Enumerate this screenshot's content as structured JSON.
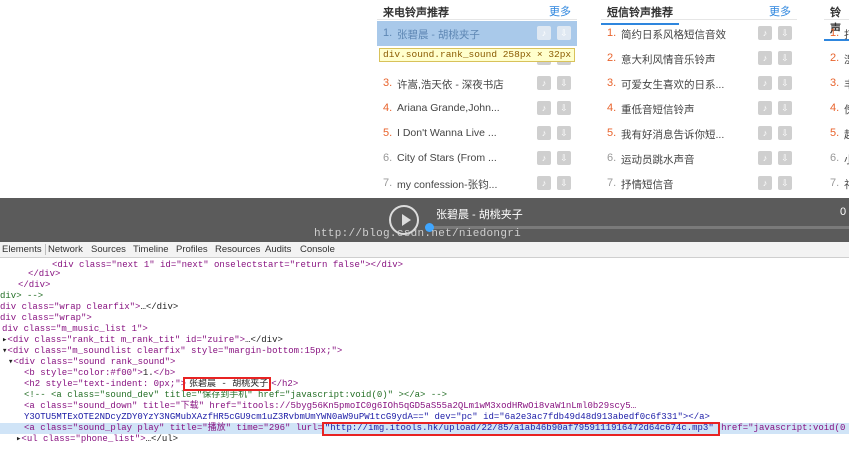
{
  "ringtone_panel": {
    "title": "来电铃声推荐",
    "more": "更多",
    "items": [
      {
        "num": "1.",
        "name": "张碧晨 - 胡桃夹子"
      },
      {
        "num": "2.",
        "name": ""
      },
      {
        "num": "3.",
        "name": "许嵩,浩天依 - 深夜书店"
      },
      {
        "num": "4.",
        "name": "Ariana Grande,John..."
      },
      {
        "num": "5.",
        "name": "I Don't Wanna Live ..."
      },
      {
        "num": "6.",
        "name": "City of Stars (From ..."
      },
      {
        "num": "7.",
        "name": "my confession-张钧..."
      }
    ]
  },
  "sms_panel": {
    "title": "短信铃声推荐",
    "more": "更多",
    "items": [
      {
        "num": "1.",
        "name": "简约日系风格短信音效"
      },
      {
        "num": "2.",
        "name": "意大利风情音乐铃声"
      },
      {
        "num": "3.",
        "name": "可爱女生喜欢的日系..."
      },
      {
        "num": "4.",
        "name": "重低音短信铃声"
      },
      {
        "num": "5.",
        "name": "我有好消息告诉你短..."
      },
      {
        "num": "6.",
        "name": "运动员跳水声音"
      },
      {
        "num": "7.",
        "name": "抒情短信音"
      }
    ]
  },
  "third_panel": {
    "title": "铃声",
    "items": [
      {
        "num": "1.",
        "name": "打"
      },
      {
        "num": "2.",
        "name": "湿"
      },
      {
        "num": "3.",
        "name": "丰"
      },
      {
        "num": "4.",
        "name": "傀"
      },
      {
        "num": "5.",
        "name": "起"
      },
      {
        "num": "6.",
        "name": "小"
      },
      {
        "num": "7.",
        "name": "礼"
      }
    ]
  },
  "tooltip": "div.sound.rank_sound 258px × 32px",
  "player": {
    "song": "张碧晨 - 胡桃夹子",
    "time": "0",
    "progress": 0
  },
  "watermark": "http://blog.csdn.net/niedongri",
  "devtools": {
    "tabs": [
      "Elements",
      "Network",
      "Sources",
      "Timeline",
      "Profiles",
      "Resources",
      "Audits",
      "Console"
    ]
  },
  "icons": {
    "ring_icon": "headphone-icon",
    "download_icon": "download-icon",
    "play_icon": "play-icon"
  },
  "colors": {
    "accent": "#2e86de",
    "hot_number": "#e8632c",
    "highlight_row": "#a9c9ea",
    "player_bg": "#5b5b5b",
    "devtools_highlight": "#d0e4f7",
    "annotation_box": "#e82323"
  },
  "code": {
    "l0": "<div class=\"next 1\" id=\"next\" onselectstart=\"return false\"></div>",
    "l1": "</div>",
    "l2": "</div>",
    "l3": "div> -->",
    "l4a": "div class=\"wrap clearfix\">",
    "l4b": "…</div>",
    "l5": "div class=\"wrap\">",
    "l6": "div class=\"m_music_list 1\">",
    "l7a": "<div class=\"rank_tit m_rank_tit\" id=\"zuire\">",
    "l7b": "…</div>",
    "l8a": "<div class=\"m_soundlist clearfix\" style=\"margin-bottom:15px;\">",
    "l9a": "<div class=\"sound rank_sound\">",
    "l10a": "<b style=\"color:#f00\">",
    "l10b": "1.",
    "l10c": "</b>",
    "l11a": "<h2 style=\"text-indent: 0px;\">",
    "l11b": "张碧晨 - 胡桃夹子",
    "l11c": "</h2>",
    "l12": "<!-- <a class=\"sound_dev\" title=\"保存到手机\" href=\"javascript:void(0)\" ></a> -->",
    "l13": "<a class=\"sound_down\" title=\"下载\" href=\"itools://5byg56Kn5pmoIC0g6IOh5qGD5aS55a2QLm1wM3xodHRwOi8vaW1nLml0b29scy5…",
    "l14": "Y3OTU5MTExOTE2NDcyZDY0YzY3NGMubXAzfHR5cGU9cm1uZ3RvbmUmYWN0aW9uPW1tcG9ydA==\" dev=\"pc\" id=\"6a2e3ac7fdb49d48d913abedf0c6f331\"></a>",
    "l15a": "<a class=\"sound_play play\" title=\"播放\" time=\"296\" lurl=",
    "l15b": "\"http://img.itools.hk/upload/22/85/a1ab46b90af7959111916472d64c674c.mp3\"",
    "l15c": " href=\"javascript:void(0",
    "l16a": "<ul class=\"phone_list\">",
    "l16b": "…</ul>"
  }
}
